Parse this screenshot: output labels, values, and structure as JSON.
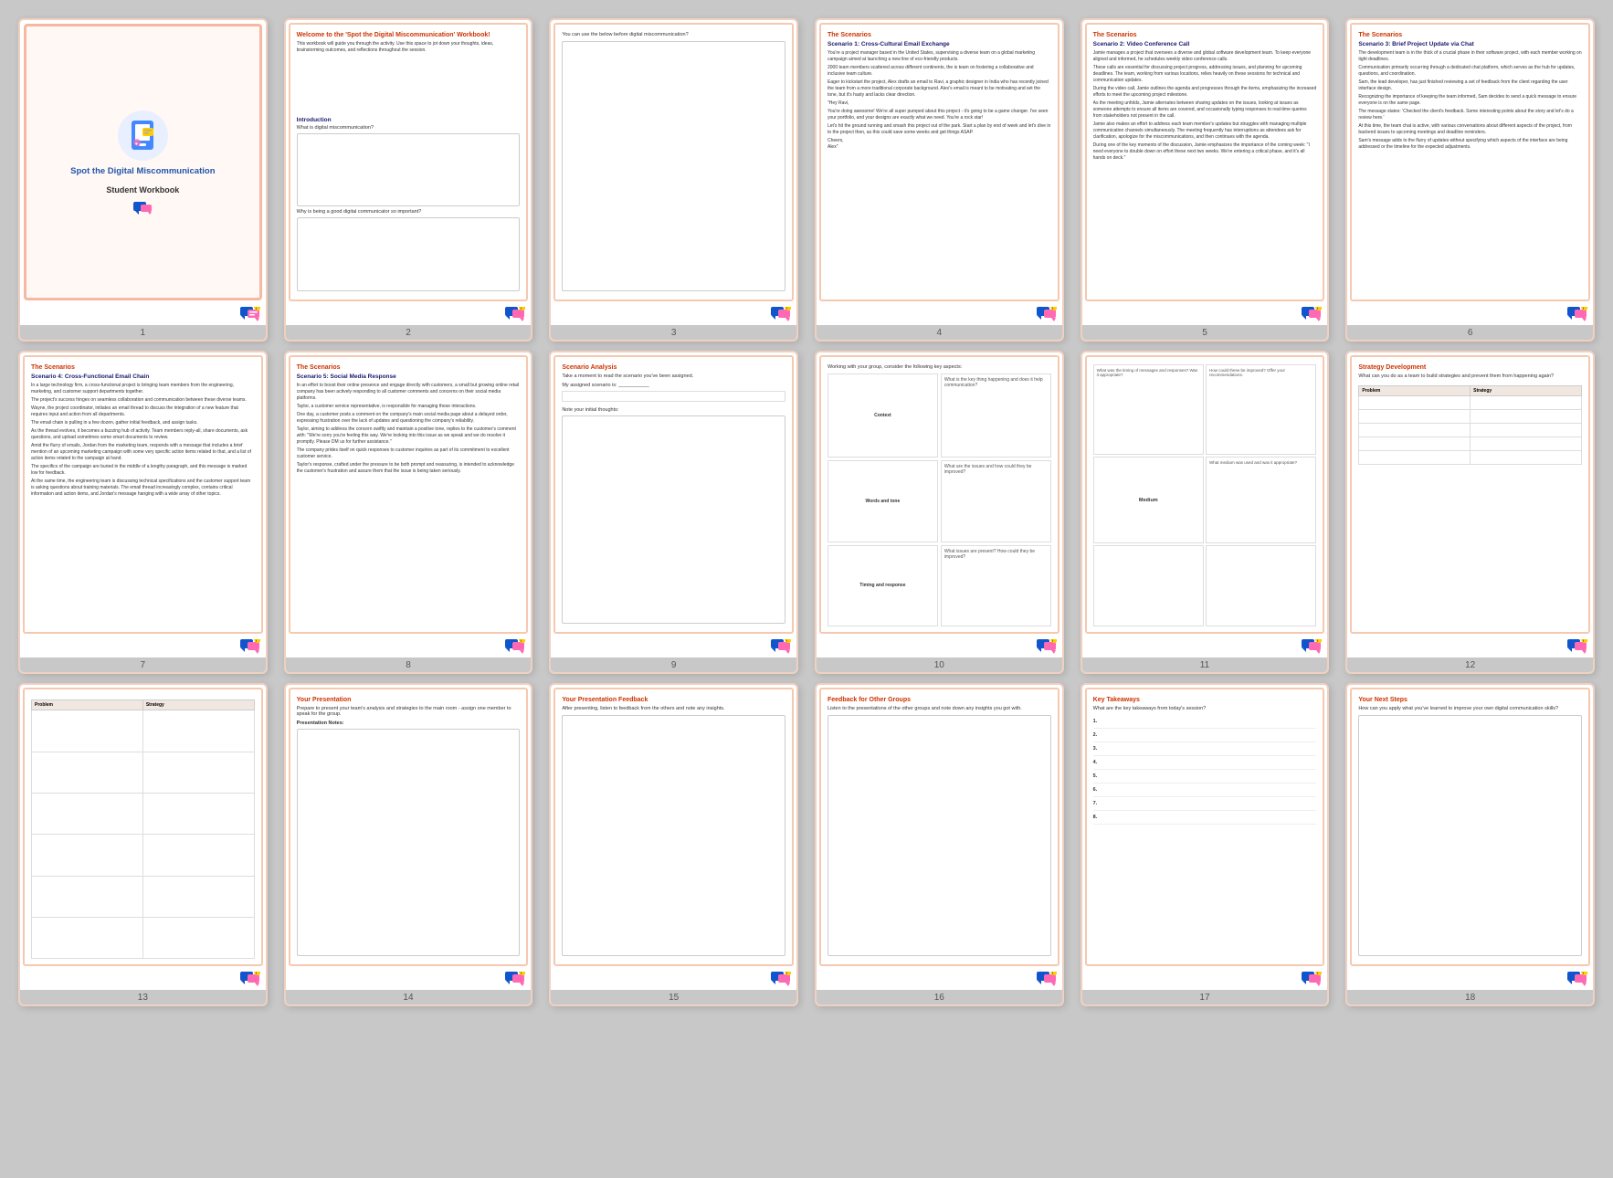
{
  "pages": [
    {
      "id": 1,
      "type": "cover",
      "title": "Spot the Digital Miscommunication",
      "subtitle": "Student Workbook"
    },
    {
      "id": 2,
      "type": "intro",
      "header": "Welcome to the 'Spot the Digital Miscommunication' Workbook!",
      "body": "This workbook will guide you through the activity. Use this space to jot down your thoughts, ideas, brainstorming outcomes, and reflections throughout the session.",
      "section": "Introduction",
      "question": "What is digital miscommunication?",
      "question2": "Why is being a good digital communicator so important?"
    },
    {
      "id": 3,
      "type": "blank_activity",
      "prompt": "You can use the below before digital miscommunication?"
    },
    {
      "id": 4,
      "type": "scenario",
      "header": "The Scenarios",
      "title": "Scenario 1: Cross-Cultural Email Exchange",
      "body": "You're a project manager based in the United States, supervising a diverse team on a global marketing campaign aimed at launching a new line of eco-friendly products.\n\n2000 team members scattered across different continents, the is team on fostering a collaborative and inclusive team culture.\n\nEager to kickstart the project, Alex drafts an email to Ravi, a graphic designer in India who has recently joined the team from a more traditional corporate background. Alex's email is meant to be motivating and set the tone, but it's hasty and lacks clear direction.\n\n\"Hey Ravi,\n\nYou're doing awesome! We're all super pumped about this project - it's going to be a game changer. I've seen your portfolio, and your designs are exactly what we need. You're a rock star!\n\nLet's hit the ground running and smash this project out of the park. Start a plan by end of week and let's dive in to the project then, as this could save some weeks and get things ASAP.\n\nCheers,\nAlex\""
    },
    {
      "id": 5,
      "type": "scenario",
      "header": "The Scenarios",
      "title": "Scenario 2: Video Conference Call",
      "body": "Jamie manages a project that oversees a diverse and global software development team. To keep everyone aligned and informed, he schedules weekly video conference calls.\n\nThese calls are essential for discussing project progress, addressing issues, and planning for upcoming deadlines. The team, working from various locations, relies heavily on these sessions for technical and communication updates.\n\nDuring the video call, Jamie outlines the agenda and progresses through the items, emphasizing the increased efforts to meet the upcoming project milestone.\n\nAs the meeting unfolds, Jamie alternates between sharing updates on the issues, looking at issues as someone attempts to ensure all items are covered, and occasionally typing responses to real-time queries from stakeholders not present in the call.\n\nJamie also makes an effort to address each team member's updates but struggles with managing multiple communication channels simultaneously. The meeting frequently has interruptions as attendees ask for clarification, apologize for the miscommunications, and then continues with the agenda, addressing only the instances of the primary issues for the project's success.\n\nDuring one of the key moments of the discussion, Jamie emphasizes the importance of the coming week, stating, \"I need everyone to double down on effort these next two weeks. We're entering a critical phase, and it's all hands on deck.\""
    },
    {
      "id": 6,
      "type": "scenario",
      "header": "The Scenarios",
      "title": "Scenario 3: Brief Project Update via Chat",
      "body": "The development team is in the thick of a crucial phase in their software project, with each member working on tight deadlines.\n\nCommunication primarily occurring through a dedicated chat platform, which serves as the hub for updates, questions, and coordination.\n\nSam, the lead developer, has just finished reviewing a set of feedback from the client regarding the user interface design.\n\nRecognizing the importance of keeping the team informed, Sam decides to send a quick message to ensure everyone is on the same page.\n\nThe message states: 'Checked the client's feedback. Some interesting points about the story and let's do a review here.'\n\nAt this time, the team chat is active, with various conversations about different aspects of the project, from backend issues to upcoming meetings and deadline reminders.\n\nSam's message adds to the flurry of updates without specifying which aspects of the interface are being addressed or the timeline for the expected adjustments."
    },
    {
      "id": 7,
      "type": "scenario",
      "header": "The Scenarios",
      "title": "Scenario 4: Cross-Functional Email Chain",
      "body": "In a large technology firm, a cross-functional project is bringing team members from the engineering, marketing, and customer support departments together.\n\nThe project's success hinges on seamless collaboration and communication between these diverse teams.\n\nWayne, the project coordinator, initiates an email thread to discuss the integration of a new feature that requires input and action from all departments.\n\nThe email chain is pulling in a few dozen, gather initial feedback, and assign tasks.\n\nAs the thread evolves, it becomes a buzzing hub of activity. Team members reply-all, share documents, ask questions, and upload sometimes some smart documents to review, some others list potential concerns or challenges that might arise.\n\nAmid the flurry of emails, Jordan from the marketing team, responds with a message that includes a brief mention of an upcoming marketing campaign with some very specific action items related to that, and a list of action items related to the campaign at hand tuck clear two responses or situations.\n\nThe specifics of the campaign are buried in the middle of a lengthy paragraph, and this message is marked low for feedback.\n\nAt the same time, the engineering team is discussing technical specifications and the customer support team is asking questions about training materials. The email thread increasingly complex, contains critical information and action items, and Jordan's message hanging with a wide array of other topics."
    },
    {
      "id": 8,
      "type": "scenario",
      "header": "The Scenarios",
      "title": "Scenario 5: Social Media Response",
      "body": "In an effort to boost their online presence and engage directly with customers, a small but growing online retail company has been actively responding to all customer comments and concerns on their social media platforms.\n\nTaylor, a customer service representative, is responsible for managing these interactions.\n\nOne day, a customer posts a comment on the company's main social media page about a delayed order, expressing frustration over the lack of updates and questioning the company's reliability.\n\nTaylor, aiming to address the concern swiftly and maintain a positive tone, replies to the customer's comment with: \"We're sorry you're feeling this way. We're looking into this issue as we speak and we do resolve it promptly. Please DM us for further assistance.\"\n\nThe company prides itself on quick responses to customer inquiries as part of its commitment to excellent customer service.\n\nTaylor's response, crafted under the pressure to be both prompt and reassuring, is intended to acknowledge the customer's frustration and assure them that the issue is being taken seriously."
    },
    {
      "id": 9,
      "type": "analysis",
      "header": "Scenario Analysis",
      "prompt1": "Take a moment to read the scenario you've been assigned.",
      "label1": "My assigned scenario is: ___________",
      "prompt2": "Note your initial thoughts:"
    },
    {
      "id": 10,
      "type": "group_work",
      "prompt": "Working with your group, consider the following key aspects:",
      "cells": [
        {
          "label": "Context",
          "sublabel": ""
        },
        {
          "label": "Words and tone",
          "sublabel": ""
        },
        {
          "label": "Timing and response",
          "sublabel": ""
        }
      ]
    },
    {
      "id": 11,
      "type": "timing_table",
      "header": "",
      "levels": [
        "Medium"
      ]
    },
    {
      "id": 12,
      "type": "strategy",
      "header": "Strategy Development",
      "prompt": "What can you do as a team to build strategies and prevent them from happening again?",
      "columns": [
        "Problem",
        "Strategy"
      ]
    },
    {
      "id": 13,
      "type": "strategy_blank",
      "columns": [
        "Problem",
        "Strategy"
      ]
    },
    {
      "id": 14,
      "type": "presentation",
      "header": "Your Presentation",
      "prompt": "Prepare to present your team's analysis and strategies to the main room - assign one member to speak for the group.",
      "label": "Presentation Notes:"
    },
    {
      "id": 15,
      "type": "feedback_self",
      "header": "Your Presentation Feedback",
      "prompt": "After presenting, listen to feedback from the others and note any insights."
    },
    {
      "id": 16,
      "type": "feedback_others",
      "header": "Feedback for Other Groups",
      "prompt": "Listen to the presentations of the other groups and note down any insights you got with."
    },
    {
      "id": 17,
      "type": "takeaways",
      "header": "Key Takeaways",
      "prompt": "What are the key takeaways from today's session?",
      "items": [
        "1.",
        "2.",
        "3.",
        "4.",
        "5.",
        "6.",
        "7.",
        "8."
      ]
    },
    {
      "id": 18,
      "type": "next_steps",
      "header": "Your Next Steps",
      "prompt": "How can you apply what you've learned to improve your own digital communication skills?"
    }
  ],
  "colors": {
    "accent": "#cc3300",
    "title_blue": "#1a1a6e",
    "border": "#f5c0a0",
    "bg_light": "#fff8f5",
    "footer_pink": "#e84393",
    "footer_blue": "#1155cc",
    "footer_yellow": "#ffcc00"
  },
  "footer_icon": "💬"
}
